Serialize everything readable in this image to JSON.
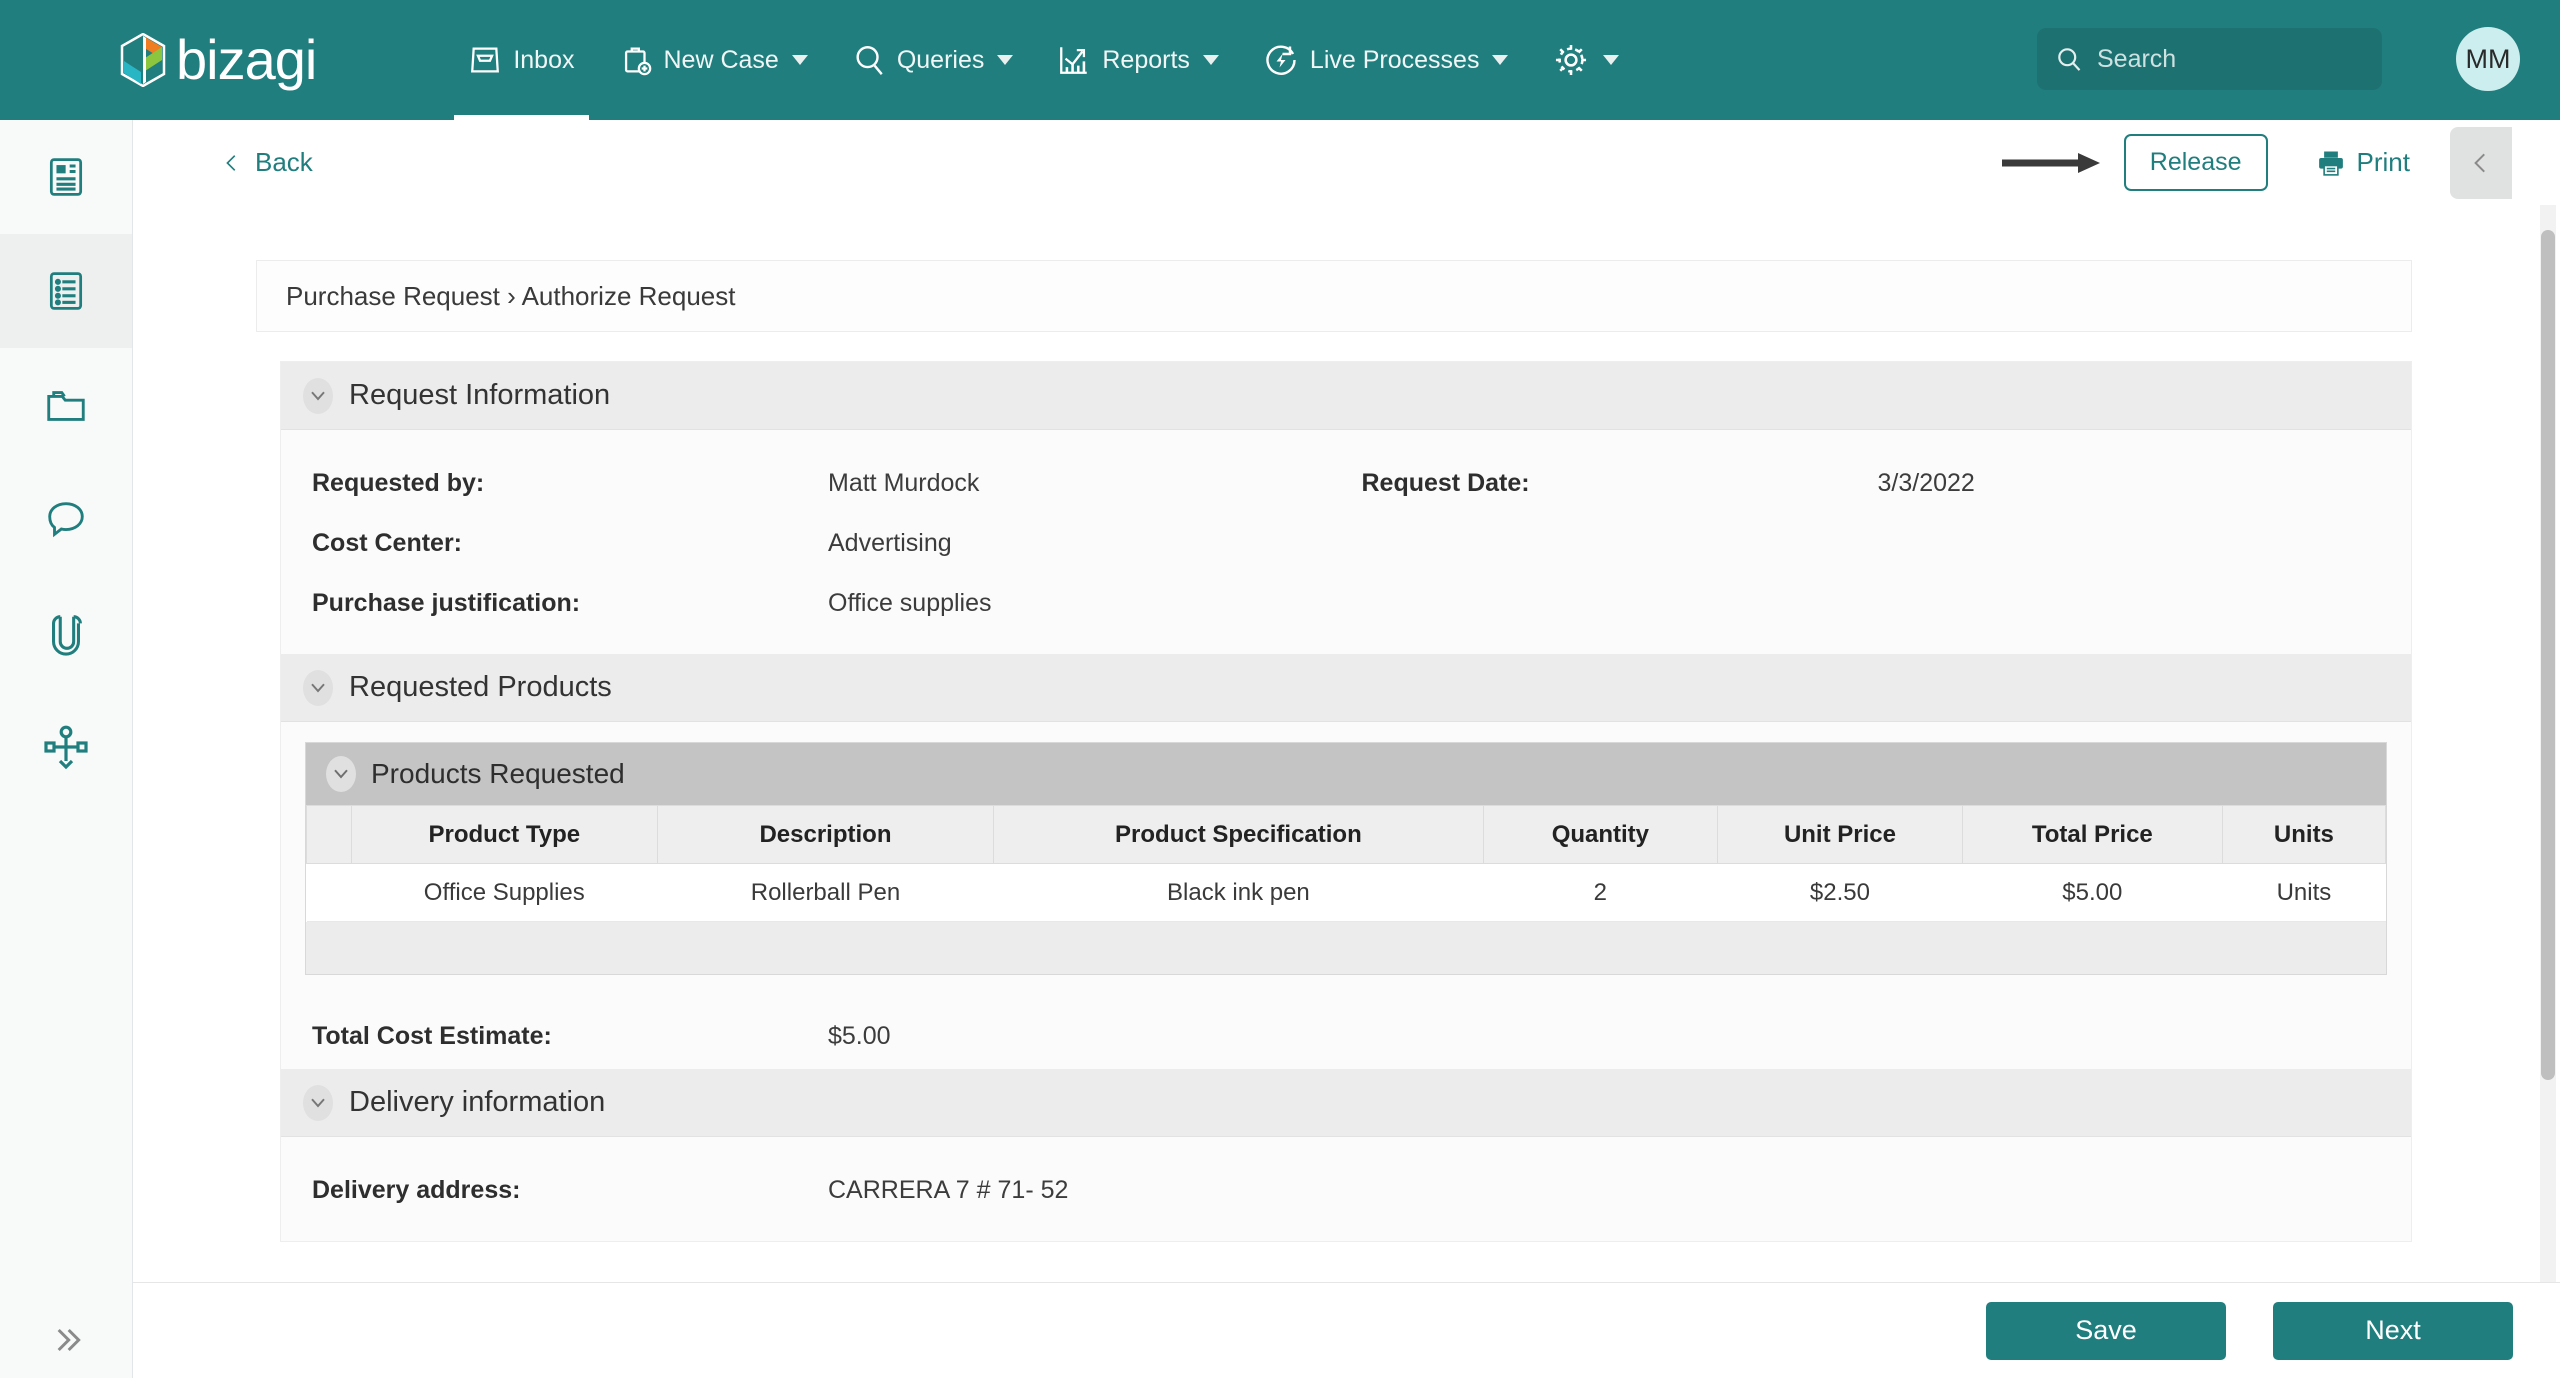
{
  "brand": {
    "name": "bizagi",
    "accent": "#217e7e"
  },
  "topnav": {
    "items": [
      {
        "label": "Inbox",
        "icon": "inbox-icon",
        "active": true,
        "has_caret": false
      },
      {
        "label": "New Case",
        "icon": "new-case-icon",
        "active": false,
        "has_caret": true
      },
      {
        "label": "Queries",
        "icon": "search-icon",
        "active": false,
        "has_caret": true
      },
      {
        "label": "Reports",
        "icon": "reports-chart-icon",
        "active": false,
        "has_caret": true
      },
      {
        "label": "Live Processes",
        "icon": "live-processes-icon",
        "active": false,
        "has_caret": true
      },
      {
        "label": "",
        "icon": "gear-icon",
        "active": false,
        "has_caret": true
      }
    ],
    "search": {
      "placeholder": "Search",
      "value": ""
    },
    "avatar": {
      "initials": "MM"
    }
  },
  "rail": {
    "items": [
      {
        "icon": "case-summary-icon",
        "selected": false
      },
      {
        "icon": "activity-list-icon",
        "selected": true
      },
      {
        "icon": "folder-icon",
        "selected": false
      },
      {
        "icon": "comments-icon",
        "selected": false
      },
      {
        "icon": "attachments-icon",
        "selected": false
      },
      {
        "icon": "process-diagram-icon",
        "selected": false
      }
    ],
    "expand": {
      "icon": "chevron-double-right-icon"
    }
  },
  "actionbar": {
    "back_label": "Back",
    "release_label": "Release",
    "print_label": "Print",
    "collapse_icon": "chevron-left-icon",
    "annotation": "arrow-pointing-to-release"
  },
  "breadcrumb": "Purchase Request › Authorize Request",
  "sections": {
    "request_information": {
      "title": "Request Information",
      "fields": [
        {
          "label": "Requested by:",
          "value": "Matt Murdock"
        },
        {
          "label": "Request Date:",
          "value": "3/3/2022"
        },
        {
          "label": "Cost Center:",
          "value": "Advertising"
        },
        {
          "label": "Purchase justification:",
          "value": "Office supplies"
        }
      ]
    },
    "requested_products": {
      "title": "Requested Products",
      "grid": {
        "title": "Products Requested",
        "columns": [
          "",
          "Product Type",
          "Description",
          "Product Specification",
          "Quantity",
          "Unit Price",
          "Total Price",
          "Units"
        ],
        "rows": [
          [
            "",
            "Office Supplies",
            "Rollerball Pen",
            "Black ink pen",
            "2",
            "$2.50",
            "$5.00",
            "Units"
          ]
        ]
      },
      "total": {
        "label": "Total Cost Estimate:",
        "value": "$5.00"
      }
    },
    "delivery_information": {
      "title": "Delivery information",
      "fields": [
        {
          "label": "Delivery address:",
          "value": "CARRERA 7 # 71- 52"
        }
      ]
    }
  },
  "bottombar": {
    "save_label": "Save",
    "next_label": "Next"
  }
}
